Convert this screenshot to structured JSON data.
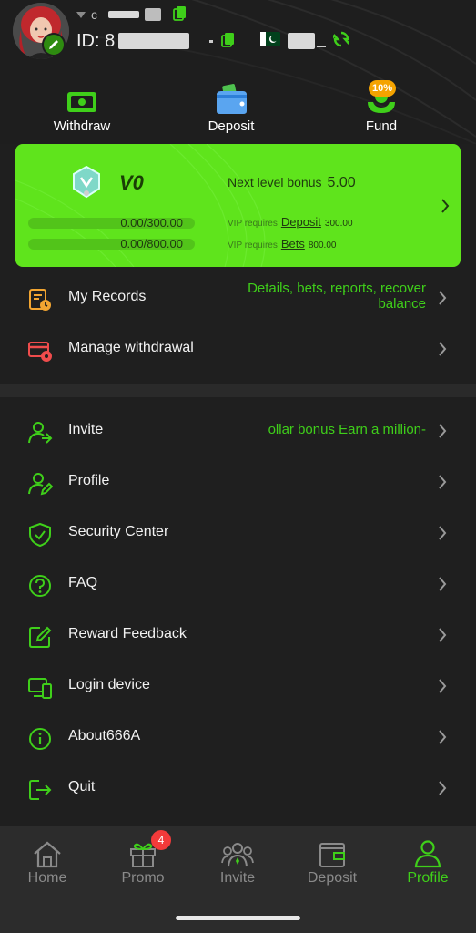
{
  "header": {
    "name_partial": "c",
    "id_prefix": "ID: 8",
    "flag_country": "PK"
  },
  "quick_actions": [
    {
      "label": "Withdraw",
      "icon": "withdraw-icon"
    },
    {
      "label": "Deposit",
      "icon": "wallet-icon"
    },
    {
      "label": "Fund",
      "icon": "fund-icon",
      "badge": "10%"
    }
  ],
  "vip": {
    "level": "V0",
    "next_label": "Next level bonus",
    "next_value": "5.00",
    "deposit_progress": "0.00/300.00",
    "bets_progress": "0.00/800.00",
    "req_prefix": "VIP requires",
    "deposit_link": "Deposit",
    "deposit_amount": "300.00",
    "bets_link": "Bets",
    "bets_amount": "800.00",
    "deposit_fraction": 0,
    "bets_fraction": 0
  },
  "menu_top": [
    {
      "label": "My Records",
      "extra_line1": "Details, bets, reports, recover",
      "extra_line2": "balance"
    },
    {
      "label": "Manage withdrawal"
    }
  ],
  "menu_main": [
    {
      "label": "Invite",
      "extra": "ollar bonus  Earn a million-"
    },
    {
      "label": "Profile"
    },
    {
      "label": "Security Center"
    },
    {
      "label": "FAQ"
    },
    {
      "label": "Reward Feedback"
    },
    {
      "label": "Login device"
    },
    {
      "label": "About666A"
    },
    {
      "label": "Quit"
    }
  ],
  "tabs": [
    {
      "label": "Home",
      "icon": "home-icon"
    },
    {
      "label": "Promo",
      "icon": "gift-icon",
      "badge": "4"
    },
    {
      "label": "Invite",
      "icon": "people-icon"
    },
    {
      "label": "Deposit",
      "icon": "wallet-icon"
    },
    {
      "label": "Profile",
      "icon": "person-icon",
      "active": true
    }
  ],
  "colors": {
    "accent": "#3fcf1a",
    "vip_card": "#5fe41c",
    "background": "#1f1f1f",
    "badge_red": "#f23a3a",
    "badge_orange": "#f5a300"
  }
}
